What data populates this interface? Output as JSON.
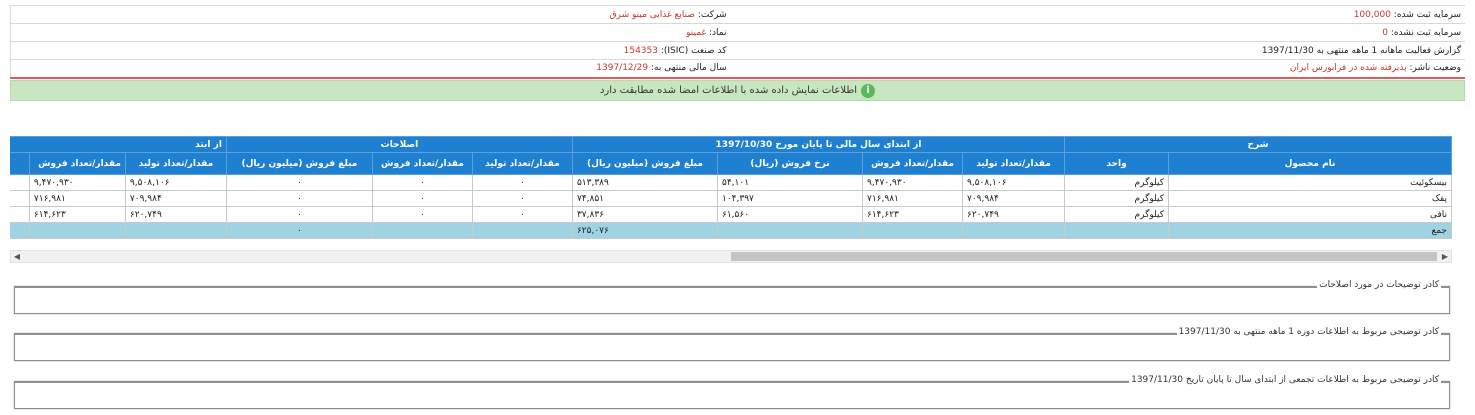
{
  "info": {
    "company_label": "شرکت:",
    "company_value": "صنایع غذایی مینو شرق",
    "registered_capital_label": "سرمایه ثبت شده:",
    "registered_capital_value": "100,000",
    "symbol_label": "نماد:",
    "symbol_value": "غمینو",
    "unregistered_capital_label": "سرمایه ثبت نشده:",
    "unregistered_capital_value": "0",
    "isic_label": "کد صنعت (ISIC):",
    "isic_value": "154353",
    "report_title": "گزارش فعالیت ماهانه 1 ماهه منتهی به 1397/11/30",
    "fiscal_year_label": "سال مالی منتهی به:",
    "fiscal_year_value": "1397/12/29",
    "publisher_status_label": "وضعیت ناشر:",
    "publisher_status_value": "پذیرفته شده در فرابورس ایران"
  },
  "notice": {
    "icon": "check-circle-icon",
    "text": "اطلاعات نمایش داده شده با اطلاعات امضا شده مطابقت دارد"
  },
  "grid": {
    "group_headers": {
      "description": "شرح",
      "from_start": "از ابتدای سال مالی تا پایان مورخ 1397/10/30",
      "corrections": "اصلاحات",
      "from_start_cut": "از ابتد"
    },
    "columns": {
      "product_name": "نام محصول",
      "unit": "واحد",
      "production_qty": "مقدار/تعداد تولید",
      "sales_qty": "مقدار/تعداد فروش",
      "sales_rate": "نرخ فروش (ریال)",
      "sales_amount": "مبلغ فروش (میلیون ریال)",
      "corr_production_qty": "مقدار/تعداد تولید",
      "corr_sales_qty": "مقدار/تعداد فروش",
      "corr_sales_amount": "مبلغ فروش (میلیون ریال)",
      "next_production_qty": "مقدار/تعداد تولید",
      "next_sales_qty_cut": "مقدار/تعداد فروش"
    },
    "rows": [
      {
        "product": "بیسکوئیت",
        "unit": "کیلوگرم",
        "prod": "۹,۵۰۸,۱۰۶",
        "sales": "۹,۴۷۰,۹۳۰",
        "rate": "۵۴,۱۰۱",
        "amount": "۵۱۳,۳۸۹",
        "c_prod": "۰",
        "c_sales": "۰",
        "c_amount": "۰",
        "n_prod": "۹,۵۰۸,۱۰۶",
        "n_sales": "۹,۴۷۰,۹۳۰"
      },
      {
        "product": "پفک",
        "unit": "کیلوگرم",
        "prod": "۷۰۹,۹۸۴",
        "sales": "۷۱۶,۹۸۱",
        "rate": "۱۰۴,۳۹۷",
        "amount": "۷۴,۸۵۱",
        "c_prod": "۰",
        "c_sales": "۰",
        "c_amount": "۰",
        "n_prod": "۷۰۹,۹۸۴",
        "n_sales": "۷۱۶,۹۸۱"
      },
      {
        "product": "نافی",
        "unit": "کیلوگرم",
        "prod": "۶۲۰,۷۴۹",
        "sales": "۶۱۴,۶۲۳",
        "rate": "۶۱,۵۶۰",
        "amount": "۳۷,۸۳۶",
        "c_prod": "۰",
        "c_sales": "۰",
        "c_amount": "۰",
        "n_prod": "۶۲۰,۷۴۹",
        "n_sales": "۶۱۴,۶۲۳"
      }
    ],
    "total": {
      "label": "جمع",
      "amount": "۶۲۵,۰۷۶",
      "c_amount": "۰"
    }
  },
  "fieldsets": {
    "corrections_notes": "کادر توضیحات در مورد اصلاحات",
    "period_notes": "کادر توضیحی مربوط به اطلاعات دوره 1 ماهه منتهی به 1397/11/30",
    "cumulative_notes": "کادر توضیحی مربوط به اطلاعات تجمعی از ابتدای سال تا پایان تاریخ 1397/11/30"
  }
}
